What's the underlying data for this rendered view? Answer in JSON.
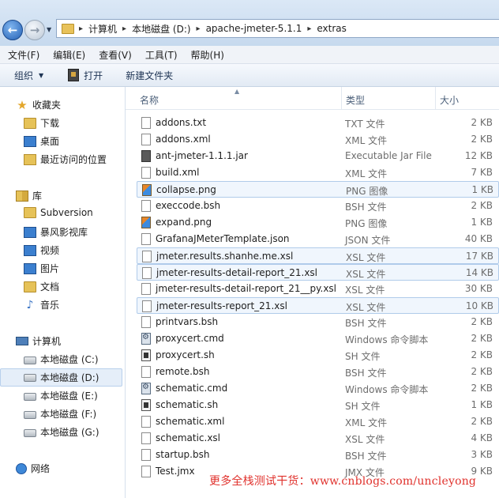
{
  "address": {
    "crumbs": [
      "计算机",
      "本地磁盘 (D:)",
      "apache-jmeter-5.1.1",
      "extras"
    ]
  },
  "menu": [
    "文件(F)",
    "编辑(E)",
    "查看(V)",
    "工具(T)",
    "帮助(H)"
  ],
  "toolbar": {
    "organize": "组织",
    "open": "打开",
    "new_folder": "新建文件夹"
  },
  "sidebar": {
    "favorites": "收藏夹",
    "favorites_items": [
      "下载",
      "桌面",
      "最近访问的位置"
    ],
    "libraries": "库",
    "library_items": [
      "Subversion",
      "暴风影视库",
      "视频",
      "图片",
      "文档",
      "音乐"
    ],
    "computer": "计算机",
    "drives": [
      "本地磁盘 (C:)",
      "本地磁盘 (D:)",
      "本地磁盘 (E:)",
      "本地磁盘 (F:)",
      "本地磁盘 (G:)"
    ],
    "selected_drive": "本地磁盘 (D:)",
    "network": "网络"
  },
  "columns": {
    "name": "名称",
    "type": "类型",
    "size": "大小"
  },
  "files": [
    {
      "name": "addons.txt",
      "type": "TXT 文件",
      "size": "2 KB",
      "icon": "text-file-icon"
    },
    {
      "name": "addons.xml",
      "type": "XML 文件",
      "size": "2 KB",
      "icon": "text-file-icon"
    },
    {
      "name": "ant-jmeter-1.1.1.jar",
      "type": "Executable Jar File",
      "size": "12 KB",
      "icon": "jar-file-icon"
    },
    {
      "name": "build.xml",
      "type": "XML 文件",
      "size": "7 KB",
      "icon": "text-file-icon"
    },
    {
      "name": "collapse.png",
      "type": "PNG 图像",
      "size": "1 KB",
      "icon": "image-file-icon"
    },
    {
      "name": "execcode.bsh",
      "type": "BSH 文件",
      "size": "2 KB",
      "icon": "text-file-icon"
    },
    {
      "name": "expand.png",
      "type": "PNG 图像",
      "size": "1 KB",
      "icon": "image-file-icon"
    },
    {
      "name": "GrafanaJMeterTemplate.json",
      "type": "JSON 文件",
      "size": "40 KB",
      "icon": "json-file-icon"
    },
    {
      "name": "jmeter.results.shanhe.me.xsl",
      "type": "XSL 文件",
      "size": "17 KB",
      "icon": "text-file-icon"
    },
    {
      "name": "jmeter-results-detail-report_21.xsl",
      "type": "XSL 文件",
      "size": "14 KB",
      "icon": "text-file-icon"
    },
    {
      "name": "jmeter-results-detail-report_21__py.xsl",
      "type": "XSL 文件",
      "size": "30 KB",
      "icon": "text-file-icon"
    },
    {
      "name": "jmeter-results-report_21.xsl",
      "type": "XSL 文件",
      "size": "10 KB",
      "icon": "text-file-icon"
    },
    {
      "name": "printvars.bsh",
      "type": "BSH 文件",
      "size": "2 KB",
      "icon": "text-file-icon"
    },
    {
      "name": "proxycert.cmd",
      "type": "Windows 命令脚本",
      "size": "2 KB",
      "icon": "cmd-file-icon"
    },
    {
      "name": "proxycert.sh",
      "type": "SH 文件",
      "size": "2 KB",
      "icon": "shell-file-icon"
    },
    {
      "name": "remote.bsh",
      "type": "BSH 文件",
      "size": "2 KB",
      "icon": "text-file-icon"
    },
    {
      "name": "schematic.cmd",
      "type": "Windows 命令脚本",
      "size": "2 KB",
      "icon": "cmd-file-icon"
    },
    {
      "name": "schematic.sh",
      "type": "SH 文件",
      "size": "1 KB",
      "icon": "shell-file-icon"
    },
    {
      "name": "schematic.xml",
      "type": "XML 文件",
      "size": "2 KB",
      "icon": "text-file-icon"
    },
    {
      "name": "schematic.xsl",
      "type": "XSL 文件",
      "size": "4 KB",
      "icon": "text-file-icon"
    },
    {
      "name": "startup.bsh",
      "type": "BSH 文件",
      "size": "3 KB",
      "icon": "text-file-icon"
    },
    {
      "name": "Test.jmx",
      "type": "JMX 文件",
      "size": "9 KB",
      "icon": "text-file-icon"
    }
  ],
  "selected_files": [
    4,
    8,
    9,
    11
  ],
  "watermark": "更多全栈测试干货：www.cnblogs.com/uncleyong"
}
